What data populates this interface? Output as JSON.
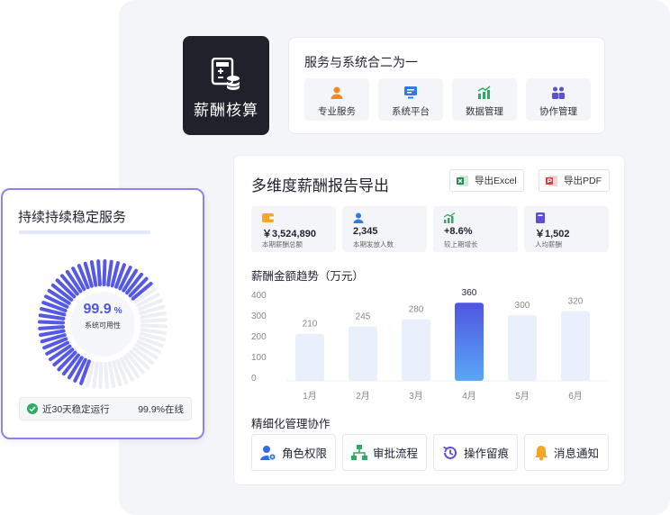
{
  "calc": {
    "title": "薪酬核算",
    "icon": "calculator-coins-icon"
  },
  "services": {
    "title": "服务与系统合二为一",
    "items": [
      {
        "label": "专业服务",
        "icon": "person-icon",
        "color": "#f08a24"
      },
      {
        "label": "系统平台",
        "icon": "monitor-icon",
        "color": "#2f7be0"
      },
      {
        "label": "数据管理",
        "icon": "chart-up-icon",
        "color": "#2eaa62"
      },
      {
        "label": "协作管理",
        "icon": "team-icon",
        "color": "#5a4fd6"
      }
    ]
  },
  "report": {
    "title": "多维度薪酬报告导出",
    "export_excel": "导出Excel",
    "export_pdf": "导出PDF",
    "stats": [
      {
        "value": "￥3,524,890",
        "caption": "本期薪酬总额",
        "icon": "wallet-icon",
        "color": "#f5a623"
      },
      {
        "value": "2,345",
        "caption": "本期发放人数",
        "icon": "person-icon",
        "color": "#2f7be0"
      },
      {
        "value": "+8.6%",
        "caption": "较上期增长",
        "icon": "trend-up-icon",
        "color": "#2eaa62"
      },
      {
        "value": "￥1,502",
        "caption": "人均薪酬",
        "icon": "book-icon",
        "color": "#5a4fd6"
      }
    ],
    "chart_title": "薪酬金额趋势（万元）",
    "collab_title": "精细化管理协作",
    "collab_items": [
      {
        "label": "角色权限",
        "icon": "user-gear-icon",
        "color": "#2f6fe0"
      },
      {
        "label": "审批流程",
        "icon": "flowchart-icon",
        "color": "#2eaa62"
      },
      {
        "label": "操作留痕",
        "icon": "history-icon",
        "color": "#5a4fd6"
      },
      {
        "label": "消息通知",
        "icon": "bell-icon",
        "color": "#f5a623"
      }
    ]
  },
  "chart_data": {
    "type": "bar",
    "categories": [
      "1月",
      "2月",
      "3月",
      "4月",
      "5月",
      "6月"
    ],
    "values": [
      210,
      245,
      280,
      360,
      300,
      320
    ],
    "ylim": [
      0,
      400
    ],
    "yticks": [
      0,
      100,
      200,
      300,
      400
    ],
    "highlight_index": 3,
    "colors": {
      "bar": "#e9effb",
      "highlight_top": "#4f55e0",
      "highlight_bottom": "#5aa7f8",
      "label": "#888888",
      "grid": "#eef0f4"
    },
    "grid": false
  },
  "stability": {
    "title": "持续持续稳定服务",
    "gauge_value": "99.9",
    "gauge_unit": "%",
    "gauge_fraction": 0.6,
    "gauge_caption": "系统可用性",
    "footer_left": "近30天稳定运行",
    "footer_right": "99.9%在线",
    "colors": {
      "active": "#5659e6",
      "inactive": "#eeeff3",
      "check": "#2eaa62"
    }
  }
}
